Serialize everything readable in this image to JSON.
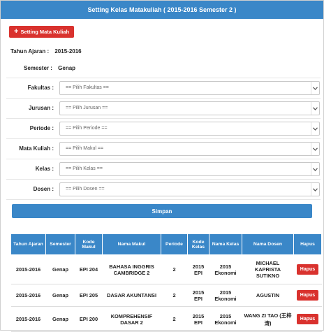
{
  "page": {
    "title": "Setting Kelas Matakuliah ( 2015-2016 Semester 2 )"
  },
  "toolbar": {
    "add_label": "Setting Mata Kuliah"
  },
  "info": {
    "tahun_label": "Tahun Ajaran :",
    "tahun_value": "2015-2016",
    "semester_label": "Semester :",
    "semester_value": "Genap"
  },
  "form": {
    "fields": [
      {
        "label": "Fakultas :",
        "value": "== Pilih Fakultas =="
      },
      {
        "label": "Jurusan :",
        "value": "== Pilih Jurusan =="
      },
      {
        "label": "Periode :",
        "value": "== Pilih Periode =="
      },
      {
        "label": "Mata Kuliah :",
        "value": "== Pilih Makul =="
      },
      {
        "label": "Kelas :",
        "value": "== Pilih Kelas =="
      },
      {
        "label": "Dosen :",
        "value": "== Pilih Dosen =="
      }
    ],
    "submit_label": "Simpan"
  },
  "table": {
    "headers": [
      "Tahun Ajaran",
      "Semester",
      "Kode Makul",
      "Nama Makul",
      "Periode",
      "Kode Kelas",
      "Nama Kelas",
      "Nama Dosen",
      "Hapus"
    ],
    "rows": [
      [
        "2015-2016",
        "Genap",
        "EPI 204",
        "BAHASA INGGRIS CAMBRIDGE 2",
        "2",
        "2015 EPI",
        "2015 Ekonomi",
        "MICHAEL KAPRISTA SUTIKNO",
        "Hapus"
      ],
      [
        "2015-2016",
        "Genap",
        "EPI 205",
        "DASAR AKUNTANSI",
        "2",
        "2015 EPI",
        "2015 Ekonomi",
        "AGUSTIN",
        "Hapus"
      ],
      [
        "2015-2016",
        "Genap",
        "EPI 200",
        "KOMPREHENSIF DASAR 2",
        "2",
        "2015 EPI",
        "2015 Ekonomi",
        "WANG ZI TAO (王梓涛)",
        "Hapus"
      ]
    ]
  },
  "colors": {
    "primary": "#3a87c8",
    "danger": "#d9322e"
  }
}
